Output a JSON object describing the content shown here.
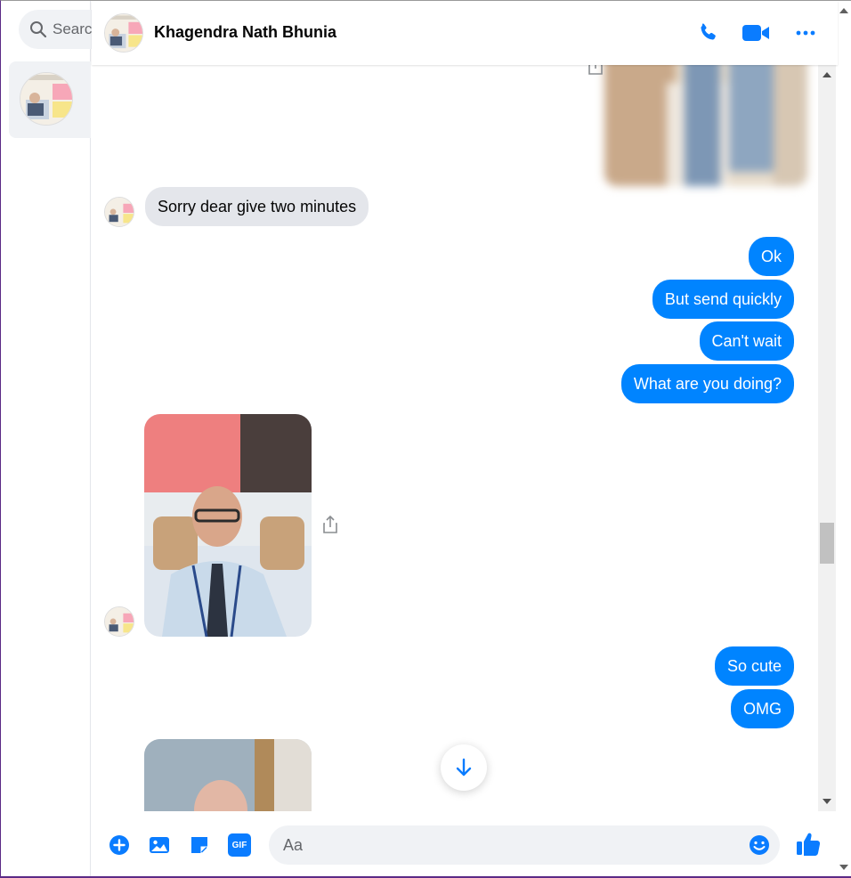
{
  "search": {
    "placeholder": "Search Messenger",
    "visible_text": "Searc"
  },
  "conversation": {
    "contact_name": "Khagendra Nath Bhunia"
  },
  "header": {
    "icons": [
      "phone-icon",
      "video-camera-icon",
      "more-options-icon"
    ]
  },
  "messages": [
    {
      "id": "m1",
      "direction": "outgoing",
      "type": "image",
      "blurred": true
    },
    {
      "id": "m2",
      "direction": "incoming",
      "type": "text",
      "text": "Sorry dear give two minutes"
    },
    {
      "id": "m3",
      "direction": "outgoing",
      "type": "text",
      "text": "Ok"
    },
    {
      "id": "m4",
      "direction": "outgoing",
      "type": "text",
      "text": "But send quickly"
    },
    {
      "id": "m5",
      "direction": "outgoing",
      "type": "text",
      "text": "Can't wait"
    },
    {
      "id": "m6",
      "direction": "outgoing",
      "type": "text",
      "text": "What are you doing?"
    },
    {
      "id": "m7",
      "direction": "incoming",
      "type": "image"
    },
    {
      "id": "m8",
      "direction": "outgoing",
      "type": "text",
      "text": "So cute"
    },
    {
      "id": "m9",
      "direction": "outgoing",
      "type": "text",
      "text": "OMG"
    },
    {
      "id": "m10",
      "direction": "incoming",
      "type": "image"
    }
  ],
  "composer": {
    "placeholder": "Aa",
    "icons": [
      "add-circle-icon",
      "photo-icon",
      "sticker-icon",
      "gif-icon",
      "emoji-icon",
      "like-icon"
    ],
    "gif_label": "GIF"
  },
  "colors": {
    "accent": "#0084ff",
    "incoming_bubble": "#e4e6eb",
    "outgoing_bubble": "#0084ff",
    "icon_blue": "#0a7cff"
  }
}
